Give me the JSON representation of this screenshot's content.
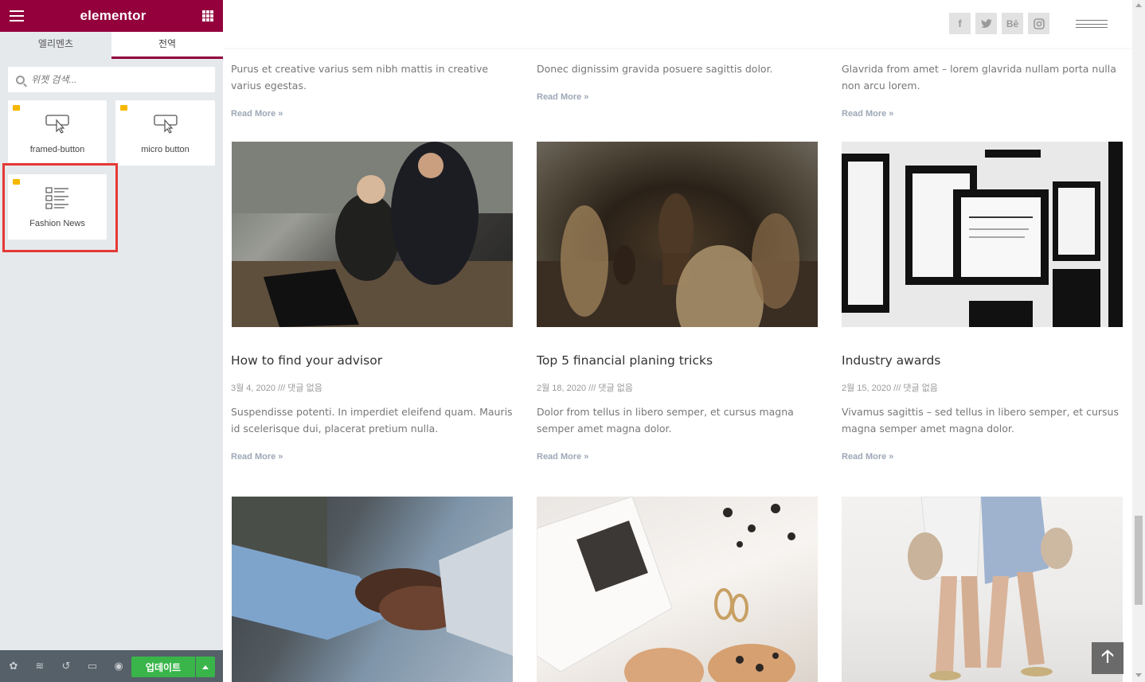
{
  "panel": {
    "brand": "elementor",
    "tabs": [
      {
        "label": "엘리멘츠"
      },
      {
        "label": "전역"
      }
    ],
    "search": {
      "placeholder": "위젯 검색..."
    },
    "widgets": [
      {
        "label": "framed-button",
        "icon": "cursor-button-icon"
      },
      {
        "label": "micro button",
        "icon": "cursor-button-icon"
      },
      {
        "label": "Fashion News",
        "icon": "post-list-icon"
      }
    ],
    "footer": {
      "update_label": "업데이트",
      "icons": [
        "settings-icon",
        "navigator-icon",
        "history-icon",
        "responsive-icon",
        "preview-icon"
      ]
    },
    "accent_color": "#93003c",
    "update_color": "#39b54a"
  },
  "site": {
    "social": [
      "f",
      "t",
      "Bē",
      "ig"
    ],
    "top_excerpts": [
      {
        "text": "Purus et creative varius sem nibh mattis in creative varius egestas.",
        "read_more": "Read More »"
      },
      {
        "text": "Donec dignissim gravida posuere sagittis dolor.",
        "read_more": "Read More »"
      },
      {
        "text": "Glavrida from amet – lorem glavrida nullam porta nulla non arcu lorem.",
        "read_more": "Read More »"
      }
    ],
    "posts": [
      {
        "title": "How to find your advisor",
        "meta": "3월 4, 2020 /// 댓글 없음",
        "excerpt": "Suspendisse potenti. In imperdiet eleifend quam. Mauris id scelerisque dui, placerat pretium nulla.",
        "read_more": "Read More »"
      },
      {
        "title": "Top 5 financial planing tricks",
        "meta": "2월 18, 2020 /// 댓글 없음",
        "excerpt": "Dolor from tellus in libero semper, et cursus magna semper amet magna dolor.",
        "read_more": "Read More »"
      },
      {
        "title": "Industry awards",
        "meta": "2월 15, 2020 /// 댓글 없음",
        "excerpt": "Vivamus sagittis – sed tellus in libero semper, et cursus magna semper amet magna dolor.",
        "read_more": "Read More »"
      }
    ]
  }
}
